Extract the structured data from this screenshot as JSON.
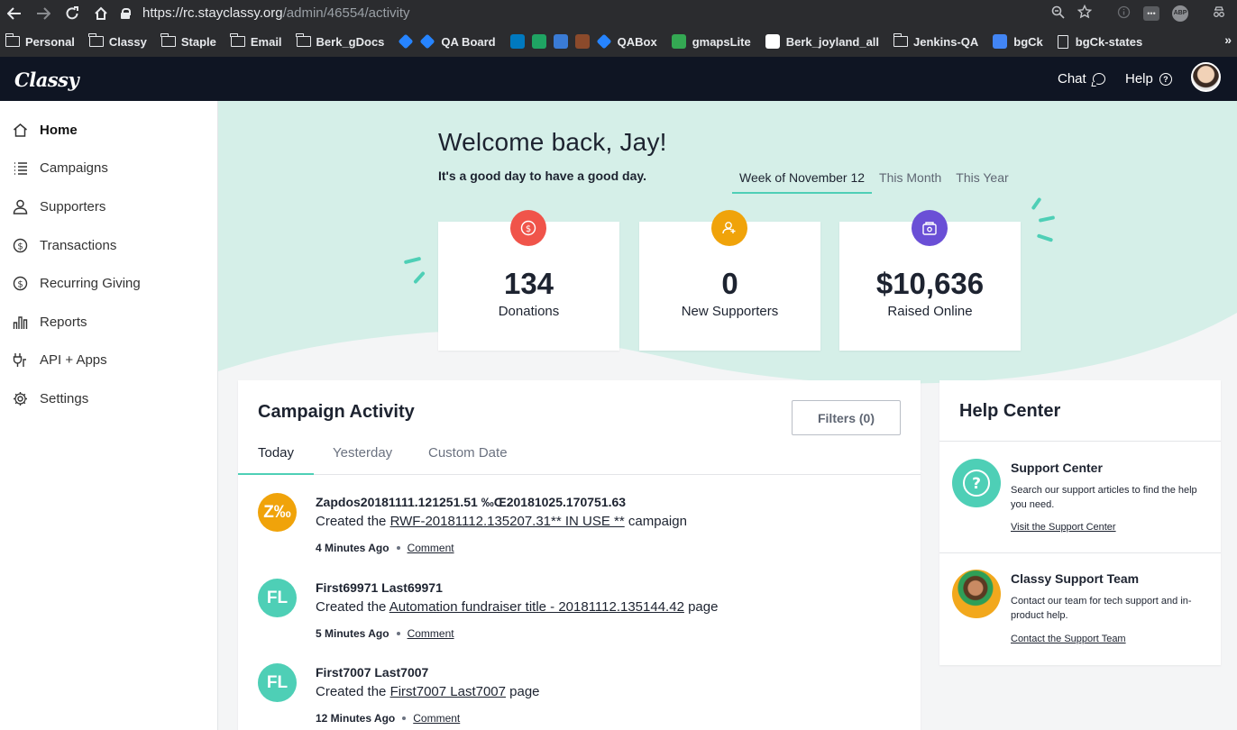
{
  "browser": {
    "url_host": "https://rc.stayclassy.org",
    "url_path": "/admin/46554/activity",
    "ext_abp": "ABP",
    "ext_more": "•••",
    "bookmarks_more": "»",
    "bookmarks": [
      {
        "label": "Personal",
        "kind": "folder"
      },
      {
        "label": "Classy",
        "kind": "folder"
      },
      {
        "label": "Staple",
        "kind": "folder"
      },
      {
        "label": "Email",
        "kind": "folder"
      },
      {
        "label": "Berk_gDocs",
        "kind": "folder"
      },
      {
        "label": "",
        "kind": "jira"
      },
      {
        "label": "QA Board",
        "kind": "jira"
      },
      {
        "label": "",
        "kind": "trello"
      },
      {
        "label": "",
        "kind": "drive"
      },
      {
        "label": "",
        "kind": "grid"
      },
      {
        "label": "",
        "kind": "pic"
      },
      {
        "label": "QABox",
        "kind": "confluence"
      },
      {
        "label": "gmapsLite",
        "kind": "maps"
      },
      {
        "label": "Berk_joyland_all",
        "kind": "mail"
      },
      {
        "label": "Jenkins-QA",
        "kind": "folder"
      },
      {
        "label": "bgCk",
        "kind": "doc"
      },
      {
        "label": "bgCk-states",
        "kind": "file"
      }
    ]
  },
  "header": {
    "logo": "Classy",
    "chat": "Chat",
    "help": "Help",
    "help_glyph": "?"
  },
  "sidebar": {
    "items": [
      {
        "label": "Home",
        "icon": "home-icon"
      },
      {
        "label": "Campaigns",
        "icon": "list-icon"
      },
      {
        "label": "Supporters",
        "icon": "user-icon"
      },
      {
        "label": "Transactions",
        "icon": "dollar-icon"
      },
      {
        "label": "Recurring Giving",
        "icon": "dollar-icon"
      },
      {
        "label": "Reports",
        "icon": "bar-chart-icon"
      },
      {
        "label": "API + Apps",
        "icon": "plug-icon"
      },
      {
        "label": "Settings",
        "icon": "gear-icon"
      }
    ]
  },
  "hero": {
    "welcome": "Welcome back, Jay!",
    "tagline": "It's a good day to have a good day.",
    "periods": [
      "Week of November 12",
      "This Month",
      "This Year"
    ],
    "active_period": "Week of November 12"
  },
  "stats": [
    {
      "value": "134",
      "label": "Donations",
      "icon": "dollar-coin-icon",
      "color": "#f0544a"
    },
    {
      "value": "0",
      "label": "New Supporters",
      "icon": "add-user-icon",
      "color": "#f0a30a"
    },
    {
      "value": "$10,636",
      "label": "Raised Online",
      "icon": "wallet-icon",
      "color": "#6a4fd6"
    }
  ],
  "activity": {
    "title": "Campaign Activity",
    "filters": "Filters (0)",
    "tabs": [
      "Today",
      "Yesterday",
      "Custom Date"
    ],
    "comment_label": "Comment",
    "items": [
      {
        "initials": "Z‰",
        "avatar_color": "#f0a30a",
        "name": "Zapdos20181111.121251.51 ‰Œ20181025.170751.63",
        "prefix": "Created the",
        "link": "RWF-20181112.135207.31** IN USE **",
        "suffix": "campaign",
        "time": "4 Minutes Ago"
      },
      {
        "initials": "FL",
        "avatar_color": "#4ecfb6",
        "name": "First69971 Last69971",
        "prefix": "Created the",
        "link": "Automation fundraiser title - 20181112.135144.42",
        "suffix": "page",
        "time": "5 Minutes Ago"
      },
      {
        "initials": "FL",
        "avatar_color": "#4ecfb6",
        "name": "First7007 Last7007",
        "prefix": "Created the",
        "link": "First7007 Last7007",
        "suffix": "page",
        "time": "12 Minutes Ago"
      }
    ]
  },
  "help_center": {
    "title": "Help Center",
    "sections": [
      {
        "title": "Support Center",
        "text": "Search our support articles to find the help you need.",
        "link": "Visit the Support Center",
        "icon_glyph": "?"
      },
      {
        "title": "Classy Support Team",
        "text": "Contact our team for tech support and in-product help.",
        "link": "Contact the Support Team"
      }
    ]
  },
  "colors": {
    "accent": "#4ecfb6",
    "hero_bg": "#d5efe8",
    "nav_bg": "#0f1523"
  }
}
